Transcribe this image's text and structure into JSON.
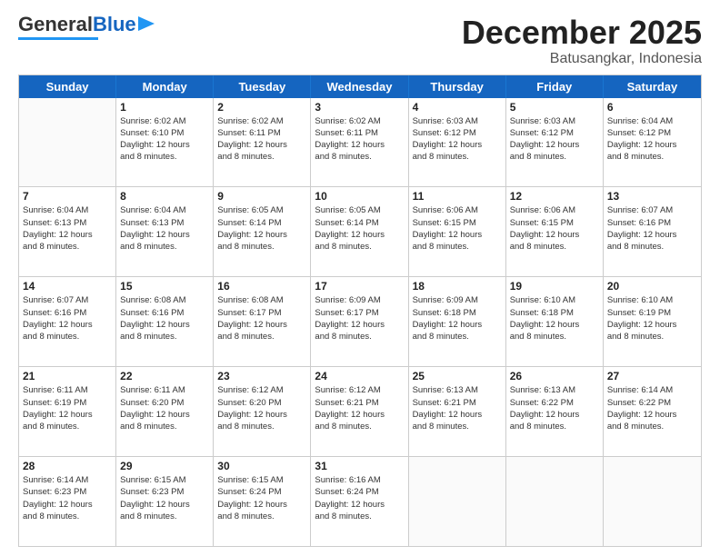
{
  "header": {
    "logo_general": "General",
    "logo_blue": "Blue",
    "month_title": "December 2025",
    "location": "Batusangkar, Indonesia"
  },
  "days_of_week": [
    "Sunday",
    "Monday",
    "Tuesday",
    "Wednesday",
    "Thursday",
    "Friday",
    "Saturday"
  ],
  "weeks": [
    [
      {
        "day": "",
        "sunrise": "",
        "sunset": "",
        "daylight1": "",
        "daylight2": ""
      },
      {
        "day": "1",
        "sunrise": "Sunrise: 6:02 AM",
        "sunset": "Sunset: 6:10 PM",
        "daylight1": "Daylight: 12 hours",
        "daylight2": "and 8 minutes."
      },
      {
        "day": "2",
        "sunrise": "Sunrise: 6:02 AM",
        "sunset": "Sunset: 6:11 PM",
        "daylight1": "Daylight: 12 hours",
        "daylight2": "and 8 minutes."
      },
      {
        "day": "3",
        "sunrise": "Sunrise: 6:02 AM",
        "sunset": "Sunset: 6:11 PM",
        "daylight1": "Daylight: 12 hours",
        "daylight2": "and 8 minutes."
      },
      {
        "day": "4",
        "sunrise": "Sunrise: 6:03 AM",
        "sunset": "Sunset: 6:12 PM",
        "daylight1": "Daylight: 12 hours",
        "daylight2": "and 8 minutes."
      },
      {
        "day": "5",
        "sunrise": "Sunrise: 6:03 AM",
        "sunset": "Sunset: 6:12 PM",
        "daylight1": "Daylight: 12 hours",
        "daylight2": "and 8 minutes."
      },
      {
        "day": "6",
        "sunrise": "Sunrise: 6:04 AM",
        "sunset": "Sunset: 6:12 PM",
        "daylight1": "Daylight: 12 hours",
        "daylight2": "and 8 minutes."
      }
    ],
    [
      {
        "day": "7",
        "sunrise": "Sunrise: 6:04 AM",
        "sunset": "Sunset: 6:13 PM",
        "daylight1": "Daylight: 12 hours",
        "daylight2": "and 8 minutes."
      },
      {
        "day": "8",
        "sunrise": "Sunrise: 6:04 AM",
        "sunset": "Sunset: 6:13 PM",
        "daylight1": "Daylight: 12 hours",
        "daylight2": "and 8 minutes."
      },
      {
        "day": "9",
        "sunrise": "Sunrise: 6:05 AM",
        "sunset": "Sunset: 6:14 PM",
        "daylight1": "Daylight: 12 hours",
        "daylight2": "and 8 minutes."
      },
      {
        "day": "10",
        "sunrise": "Sunrise: 6:05 AM",
        "sunset": "Sunset: 6:14 PM",
        "daylight1": "Daylight: 12 hours",
        "daylight2": "and 8 minutes."
      },
      {
        "day": "11",
        "sunrise": "Sunrise: 6:06 AM",
        "sunset": "Sunset: 6:15 PM",
        "daylight1": "Daylight: 12 hours",
        "daylight2": "and 8 minutes."
      },
      {
        "day": "12",
        "sunrise": "Sunrise: 6:06 AM",
        "sunset": "Sunset: 6:15 PM",
        "daylight1": "Daylight: 12 hours",
        "daylight2": "and 8 minutes."
      },
      {
        "day": "13",
        "sunrise": "Sunrise: 6:07 AM",
        "sunset": "Sunset: 6:16 PM",
        "daylight1": "Daylight: 12 hours",
        "daylight2": "and 8 minutes."
      }
    ],
    [
      {
        "day": "14",
        "sunrise": "Sunrise: 6:07 AM",
        "sunset": "Sunset: 6:16 PM",
        "daylight1": "Daylight: 12 hours",
        "daylight2": "and 8 minutes."
      },
      {
        "day": "15",
        "sunrise": "Sunrise: 6:08 AM",
        "sunset": "Sunset: 6:16 PM",
        "daylight1": "Daylight: 12 hours",
        "daylight2": "and 8 minutes."
      },
      {
        "day": "16",
        "sunrise": "Sunrise: 6:08 AM",
        "sunset": "Sunset: 6:17 PM",
        "daylight1": "Daylight: 12 hours",
        "daylight2": "and 8 minutes."
      },
      {
        "day": "17",
        "sunrise": "Sunrise: 6:09 AM",
        "sunset": "Sunset: 6:17 PM",
        "daylight1": "Daylight: 12 hours",
        "daylight2": "and 8 minutes."
      },
      {
        "day": "18",
        "sunrise": "Sunrise: 6:09 AM",
        "sunset": "Sunset: 6:18 PM",
        "daylight1": "Daylight: 12 hours",
        "daylight2": "and 8 minutes."
      },
      {
        "day": "19",
        "sunrise": "Sunrise: 6:10 AM",
        "sunset": "Sunset: 6:18 PM",
        "daylight1": "Daylight: 12 hours",
        "daylight2": "and 8 minutes."
      },
      {
        "day": "20",
        "sunrise": "Sunrise: 6:10 AM",
        "sunset": "Sunset: 6:19 PM",
        "daylight1": "Daylight: 12 hours",
        "daylight2": "and 8 minutes."
      }
    ],
    [
      {
        "day": "21",
        "sunrise": "Sunrise: 6:11 AM",
        "sunset": "Sunset: 6:19 PM",
        "daylight1": "Daylight: 12 hours",
        "daylight2": "and 8 minutes."
      },
      {
        "day": "22",
        "sunrise": "Sunrise: 6:11 AM",
        "sunset": "Sunset: 6:20 PM",
        "daylight1": "Daylight: 12 hours",
        "daylight2": "and 8 minutes."
      },
      {
        "day": "23",
        "sunrise": "Sunrise: 6:12 AM",
        "sunset": "Sunset: 6:20 PM",
        "daylight1": "Daylight: 12 hours",
        "daylight2": "and 8 minutes."
      },
      {
        "day": "24",
        "sunrise": "Sunrise: 6:12 AM",
        "sunset": "Sunset: 6:21 PM",
        "daylight1": "Daylight: 12 hours",
        "daylight2": "and 8 minutes."
      },
      {
        "day": "25",
        "sunrise": "Sunrise: 6:13 AM",
        "sunset": "Sunset: 6:21 PM",
        "daylight1": "Daylight: 12 hours",
        "daylight2": "and 8 minutes."
      },
      {
        "day": "26",
        "sunrise": "Sunrise: 6:13 AM",
        "sunset": "Sunset: 6:22 PM",
        "daylight1": "Daylight: 12 hours",
        "daylight2": "and 8 minutes."
      },
      {
        "day": "27",
        "sunrise": "Sunrise: 6:14 AM",
        "sunset": "Sunset: 6:22 PM",
        "daylight1": "Daylight: 12 hours",
        "daylight2": "and 8 minutes."
      }
    ],
    [
      {
        "day": "28",
        "sunrise": "Sunrise: 6:14 AM",
        "sunset": "Sunset: 6:23 PM",
        "daylight1": "Daylight: 12 hours",
        "daylight2": "and 8 minutes."
      },
      {
        "day": "29",
        "sunrise": "Sunrise: 6:15 AM",
        "sunset": "Sunset: 6:23 PM",
        "daylight1": "Daylight: 12 hours",
        "daylight2": "and 8 minutes."
      },
      {
        "day": "30",
        "sunrise": "Sunrise: 6:15 AM",
        "sunset": "Sunset: 6:24 PM",
        "daylight1": "Daylight: 12 hours",
        "daylight2": "and 8 minutes."
      },
      {
        "day": "31",
        "sunrise": "Sunrise: 6:16 AM",
        "sunset": "Sunset: 6:24 PM",
        "daylight1": "Daylight: 12 hours",
        "daylight2": "and 8 minutes."
      },
      {
        "day": "",
        "sunrise": "",
        "sunset": "",
        "daylight1": "",
        "daylight2": ""
      },
      {
        "day": "",
        "sunrise": "",
        "sunset": "",
        "daylight1": "",
        "daylight2": ""
      },
      {
        "day": "",
        "sunrise": "",
        "sunset": "",
        "daylight1": "",
        "daylight2": ""
      }
    ]
  ]
}
